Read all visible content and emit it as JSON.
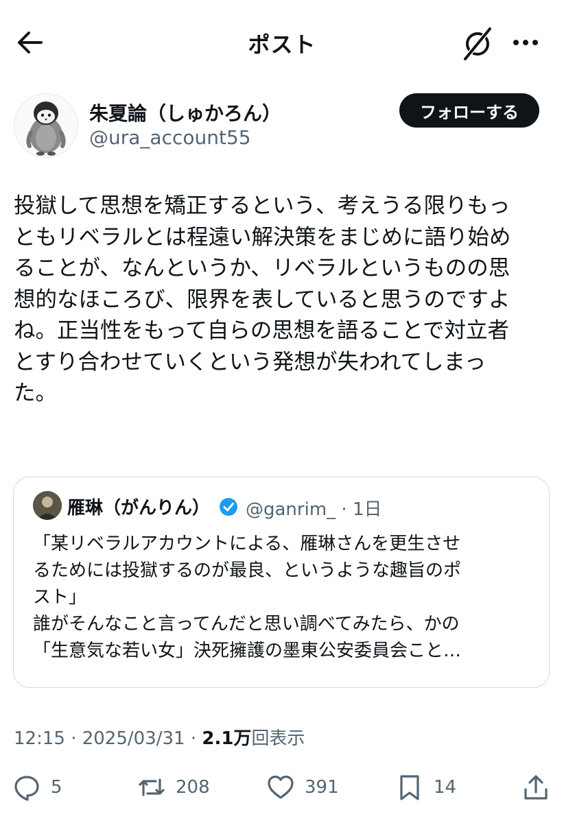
{
  "header": {
    "title": "ポスト",
    "back_icon": "arrow-left-icon",
    "grok_icon": "grok-icon",
    "more_icon": "more-dots-icon"
  },
  "author": {
    "display_name": "朱夏論（しゅかろん）",
    "handle": "@ura_account55",
    "follow_label": "フォローする"
  },
  "post": {
    "lines": [
      "投獄して思想を矯正するという、考えうる限りもっ",
      "ともリベラルとは程遠い解決策をまじめに語り始め",
      "ることが、なんというか、リベラルというものの思",
      "想的なほころび、限界を表していると思うのですよ",
      "ね。正当性をもって自らの思想を語ることで対立者",
      "とすり合わせていくという発想が失われてしまっ",
      "た。"
    ]
  },
  "quote": {
    "display_name": "雁琳（がんりん）",
    "handle_time": "@ganrim_ · 1日",
    "lines": [
      "「某リベラルアカウントによる、雁琳さんを更生させ",
      "るためには投獄するのが最良、というような趣旨のポ",
      "スト」",
      "誰がそんなこと言ってんだと思い調べてみたら、かの",
      "「生意気な若い女」決死擁護の墨東公安委員会こと…"
    ]
  },
  "meta": {
    "time": "12:15 · 2025/03/31 · ",
    "views_count": "2.1万",
    "views_label": "回表示"
  },
  "actions": {
    "replies": "5",
    "reposts": "208",
    "likes": "391",
    "bookmarks": "14"
  },
  "colors": {
    "text": "#0f1419",
    "secondary": "#536471",
    "border": "#cfd9de",
    "verified": "#1d9bf0"
  }
}
